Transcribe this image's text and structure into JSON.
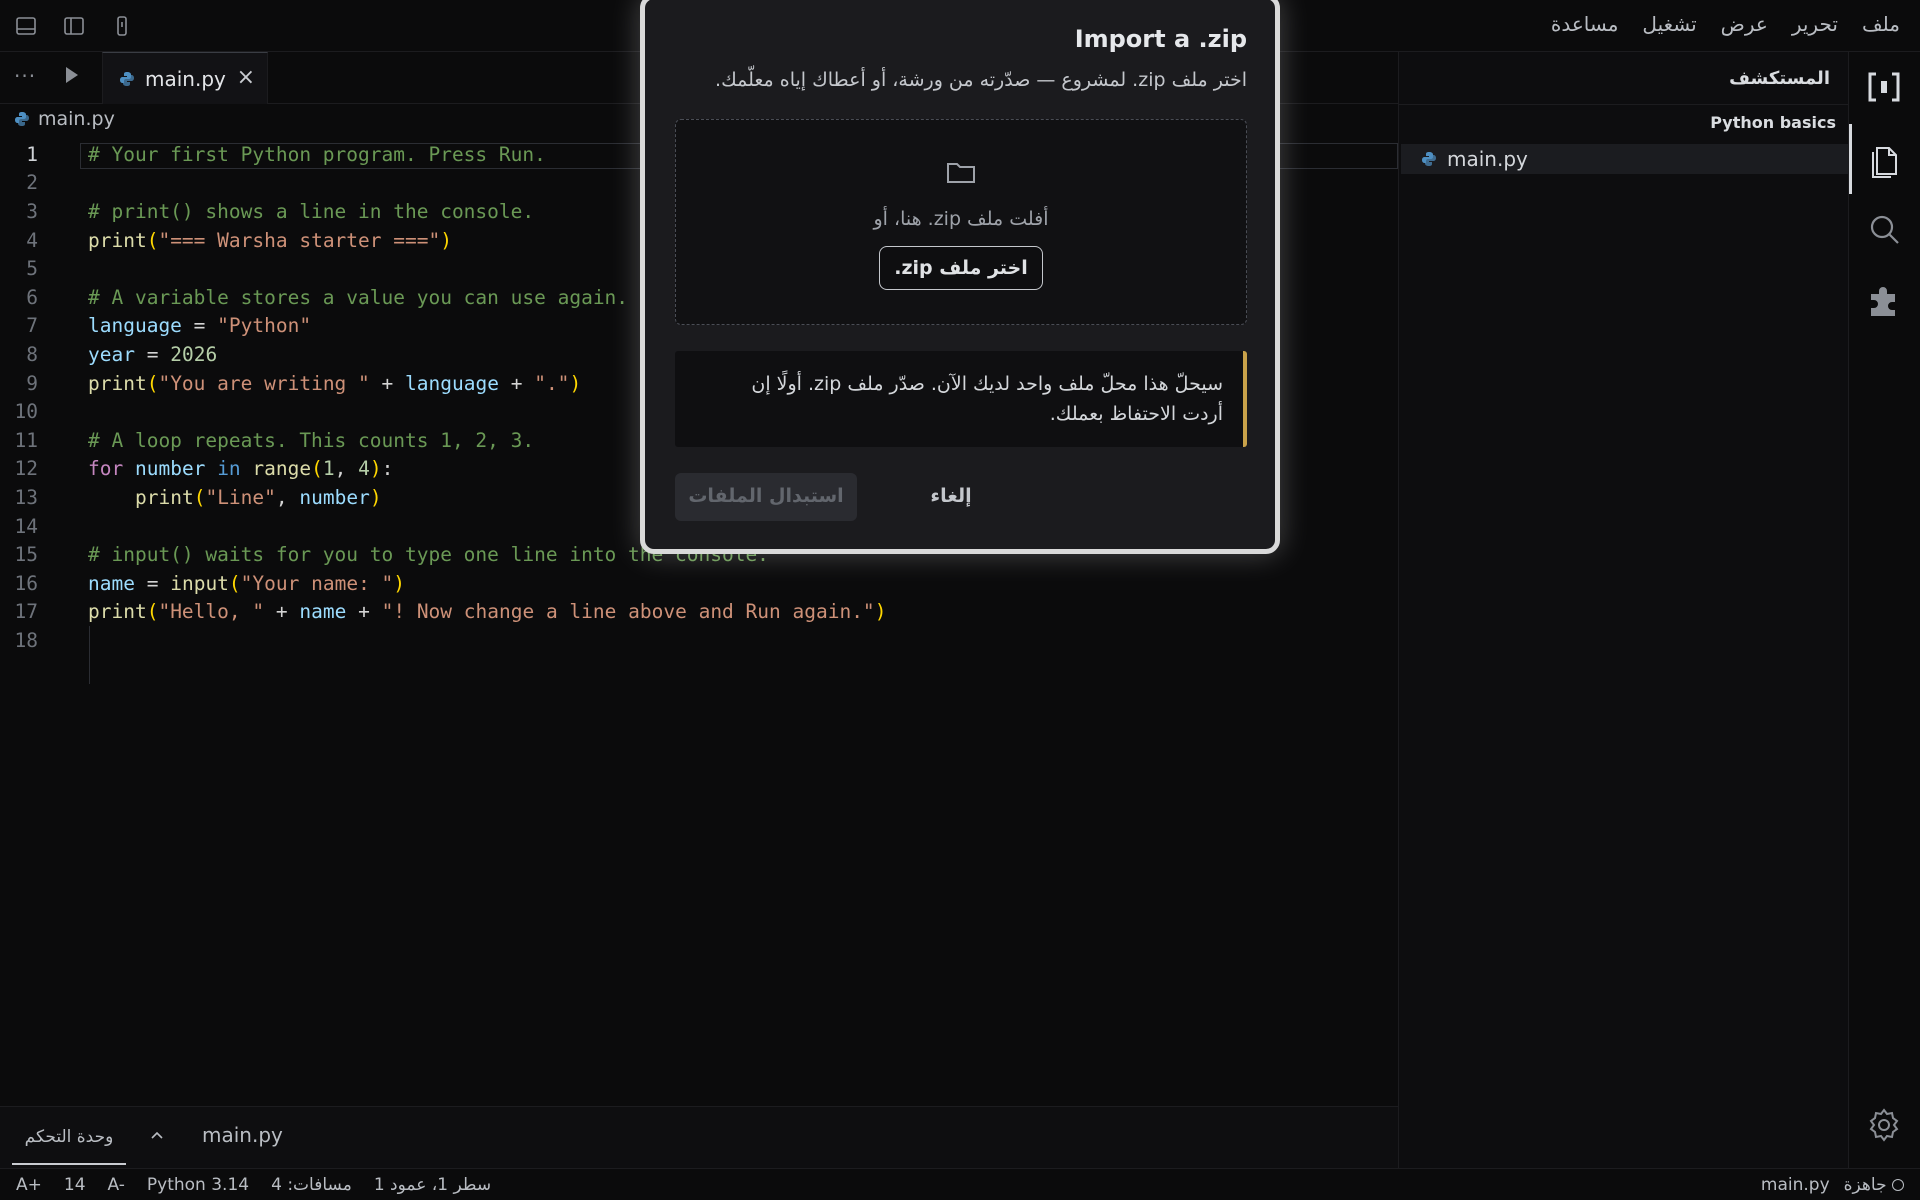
{
  "menubar": {
    "menus": [
      "ملف",
      "تحرير",
      "عرض",
      "تشغيل",
      "مساعدة"
    ]
  },
  "tabs": {
    "active_tab": "main.py"
  },
  "breadcrumb": "main.py",
  "sidebar": {
    "title": "المستكشف",
    "section": "Python basics",
    "file": "main.py"
  },
  "editor": {
    "current_line": 1,
    "lines": [
      "# Your first Python program. Press Run.",
      "",
      "# print() shows a line in the console.",
      "print(\"=== Warsha starter ===\")",
      "",
      "# A variable stores a value you can use again.",
      "language = \"Python\"",
      "year = 2026",
      "print(\"You are writing \" + language + \".\")",
      "",
      "# A loop repeats. This counts 1, 2, 3.",
      "for number in range(1, 4):",
      "    print(\"Line\", number)",
      "",
      "# input() waits for you to type one line into the console.",
      "name = input(\"Your name: \")",
      "print(\"Hello, \" + name + \"! Now change a line above and Run again.\")",
      ""
    ]
  },
  "panel": {
    "tab_label": "وحدة التحكم",
    "file_label": "main.py"
  },
  "statusbar": {
    "font_increase": "A+",
    "font_size": "14",
    "font_decrease": "A-",
    "language": "Python 3.14",
    "spaces": "مسافات: 4",
    "position": "سطر 1، عمود 1",
    "file": "main.py",
    "status": "جاهزة"
  },
  "dialog": {
    "title": "Import a .zip",
    "subtitle": "اختر ملف zip. لمشروع — صدّرته من ورشة، أو أعطاك إياه معلّمك.",
    "drop_text": "أفلت ملف zip. هنا، أو",
    "pick_button": "اختر ملف zip.",
    "warning": "سيحلّ هذا محلّ ملف واحد لديك الآن. صدّر ملف zip. أولًا إن أردت الاحتفاظ بعملك.",
    "replace_button": "استبدال الملفات",
    "cancel_button": "إلغاء"
  },
  "colors": {
    "accent_warning": "#c9a24a",
    "comment": "#6a9955",
    "string": "#ce9178"
  }
}
